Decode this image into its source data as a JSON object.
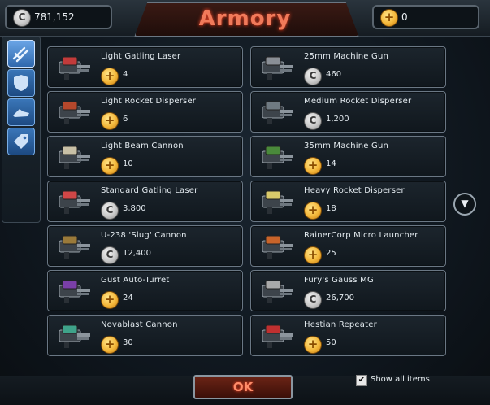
{
  "header": {
    "title": "Armory",
    "credits": "781,152",
    "gold": "0"
  },
  "sidebar": {
    "tabs": [
      {
        "icon": "guns-icon",
        "active": true
      },
      {
        "icon": "shield-icon",
        "active": false
      },
      {
        "icon": "ship-icon",
        "active": false
      },
      {
        "icon": "tag-icon",
        "active": false
      }
    ]
  },
  "items": [
    {
      "name": "Light Gatling Laser",
      "price": "4",
      "currency": "gold"
    },
    {
      "name": "25mm Machine Gun",
      "price": "460",
      "currency": "credits"
    },
    {
      "name": "Light Rocket Disperser",
      "price": "6",
      "currency": "gold"
    },
    {
      "name": "Medium Rocket Disperser",
      "price": "1,200",
      "currency": "credits"
    },
    {
      "name": "Light Beam Cannon",
      "price": "10",
      "currency": "gold"
    },
    {
      "name": "35mm Machine Gun",
      "price": "14",
      "currency": "gold"
    },
    {
      "name": "Standard Gatling Laser",
      "price": "3,800",
      "currency": "credits"
    },
    {
      "name": "Heavy Rocket Disperser",
      "price": "18",
      "currency": "gold"
    },
    {
      "name": "U-238 'Slug' Cannon",
      "price": "12,400",
      "currency": "credits"
    },
    {
      "name": "RainerCorp Micro Launcher",
      "price": "25",
      "currency": "gold"
    },
    {
      "name": "Gust Auto-Turret",
      "price": "24",
      "currency": "gold"
    },
    {
      "name": "Fury's Gauss MG",
      "price": "26,700",
      "currency": "credits"
    },
    {
      "name": "Novablast Cannon",
      "price": "30",
      "currency": "gold"
    },
    {
      "name": "Hestian Repeater",
      "price": "50",
      "currency": "gold"
    }
  ],
  "footer": {
    "ok_label": "OK",
    "show_all_label": "Show all items",
    "show_all_checked": true
  },
  "colors": {
    "title": "#f07a5a",
    "tab_active": "#6aa5e6",
    "tab": "#3a76b8",
    "gold_coin": "#f4b73a",
    "credit_coin": "#c9c9c9"
  }
}
